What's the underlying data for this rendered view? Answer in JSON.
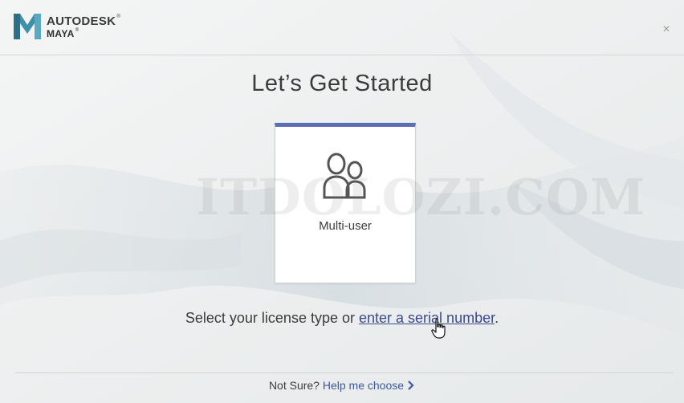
{
  "header": {
    "company": "AUTODESK",
    "product": "MAYA",
    "registered_mark": "®",
    "close_glyph": "×"
  },
  "main": {
    "title": "Let’s Get Started",
    "license_cards": [
      {
        "label": "Multi-user",
        "icon": "multi-user-icon",
        "selected": true
      }
    ],
    "accent_color": "#5b6fb5",
    "watermark_text": "ITDOLOZI.COM",
    "license_prompt": "Select your license type or",
    "serial_link": "enter a serial number",
    "prompt_end": "."
  },
  "footer": {
    "not_sure": "Not Sure?",
    "help_link": "Help me choose",
    "help_icon": "chevron-right-icon"
  }
}
